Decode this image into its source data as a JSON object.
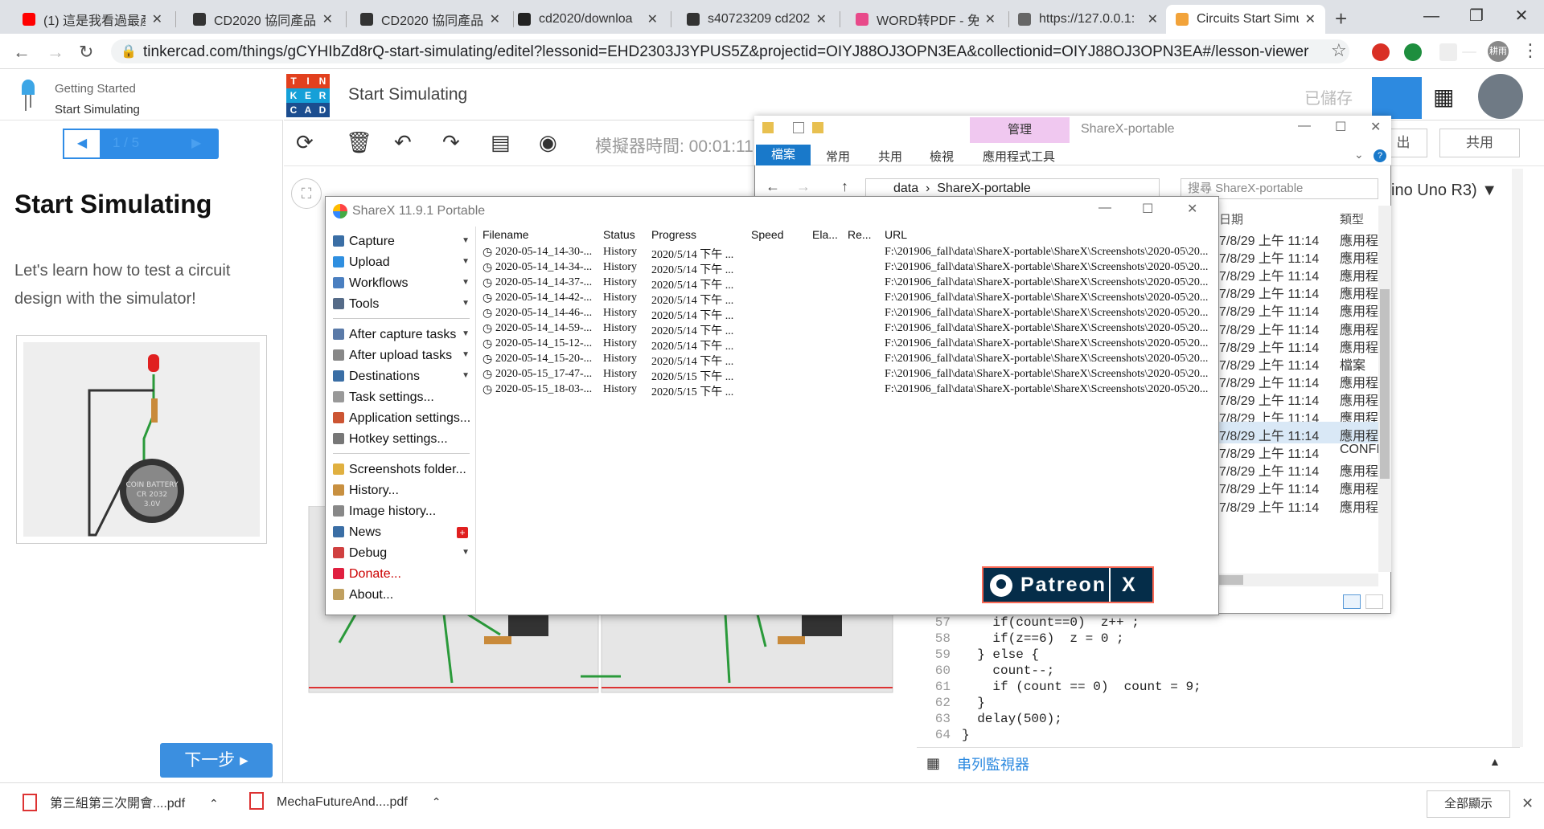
{
  "browser": {
    "tabs": [
      {
        "title": "(1) 這是我看過最產",
        "color": "#ff0000"
      },
      {
        "title": "CD2020 協同產品",
        "color": "#333333"
      },
      {
        "title": "CD2020 協同產品",
        "color": "#333333"
      },
      {
        "title": "cd2020/downloa",
        "color": "#222222"
      },
      {
        "title": "s40723209 cd202",
        "color": "#333333"
      },
      {
        "title": "WORD转PDF - 免",
        "color": "#e84a8a"
      },
      {
        "title": "https://127.0.0.1:",
        "color": "#666666"
      },
      {
        "title": "Circuits Start Simu",
        "color": "#f2a33a"
      }
    ],
    "url": "tinkercad.com/things/gCYHIbZd8rQ-start-simulating/editel?lessonid=EHD2303J3YPUS5Z&projectid=OIYJ88OJ3OPN3EA&collectionid=OIYJ88OJ3OPN3EA#/lesson-viewer",
    "profile_label": "耕雨"
  },
  "lesson": {
    "breadcrumb_top": "Getting Started",
    "breadcrumb_bottom": "Start Simulating",
    "pager": "1 / 5",
    "title": "Start Simulating",
    "text": "Let's learn how to test a circuit design with the simulator!",
    "next_label": "下一步 ▸"
  },
  "tinkercad": {
    "logo_letters": [
      "T",
      "I",
      "N",
      "K",
      "E",
      "R",
      "C",
      "A",
      "D"
    ],
    "logo_colors": [
      "#e2401e",
      "#e2401e",
      "#e2401e",
      "#15a0d8",
      "#15a0d8",
      "#15a0d8",
      "#1b4d8f",
      "#1b4d8f",
      "#1b4d8f"
    ],
    "title": "Start Simulating",
    "saved": "已儲存",
    "sim_time": "模擬器時間: 00:01:11",
    "export_label": "出",
    "share_label": "共用",
    "board": "ino Uno R3)"
  },
  "code": [
    {
      "n": "57",
      "t": "    if(count==0)  z++ ;"
    },
    {
      "n": "58",
      "t": "    if(z==6)  z = 0 ;"
    },
    {
      "n": "59",
      "t": "  } else {"
    },
    {
      "n": "60",
      "t": "    count--;"
    },
    {
      "n": "61",
      "t": "    if (count == 0)  count = 9;"
    },
    {
      "n": "62",
      "t": "  }"
    },
    {
      "n": "63",
      "t": "  delay(500);"
    },
    {
      "n": "64",
      "t": "}"
    }
  ],
  "serial_monitor": "串列監視器",
  "explorer": {
    "manage_tab": "管理",
    "window_name": "ShareX-portable",
    "ribbon": [
      "檔案",
      "常用",
      "共用",
      "檢視",
      "應用程式工具"
    ],
    "path": [
      "data",
      "ShareX-portable"
    ],
    "search_placeholder": "搜尋 ShareX-portable",
    "col_date": "日期",
    "col_type": "類型",
    "rows": [
      {
        "date": "7/8/29 上午 11:14",
        "type": "應用程"
      },
      {
        "date": "7/8/29 上午 11:14",
        "type": "應用程"
      },
      {
        "date": "7/8/29 上午 11:14",
        "type": "應用程"
      },
      {
        "date": "7/8/29 上午 11:14",
        "type": "應用程"
      },
      {
        "date": "7/8/29 上午 11:14",
        "type": "應用程"
      },
      {
        "date": "7/8/29 上午 11:14",
        "type": "應用程"
      },
      {
        "date": "7/8/29 上午 11:14",
        "type": "應用程"
      },
      {
        "date": "7/8/29 上午 11:14",
        "type": "檔案"
      },
      {
        "date": "7/8/29 上午 11:14",
        "type": "應用程"
      },
      {
        "date": "7/8/29 上午 11:14",
        "type": "應用程"
      },
      {
        "date": "7/8/29 上午 11:14",
        "type": "應用程"
      },
      {
        "date": "7/8/29 上午 11:14",
        "type": "應用程"
      },
      {
        "date": "7/8/29 上午 11:14",
        "type": "CONFI"
      },
      {
        "date": "7/8/29 上午 11:14",
        "type": "應用程"
      },
      {
        "date": "7/8/29 上午 11:14",
        "type": "應用程"
      },
      {
        "date": "7/8/29 上午 11:14",
        "type": "應用程"
      }
    ]
  },
  "sharex": {
    "title": "ShareX 11.9.1 Portable",
    "menu": [
      {
        "label": "Capture",
        "color": "#3a6ea5",
        "arrow": true
      },
      {
        "label": "Upload",
        "color": "#2f8fe0",
        "arrow": true
      },
      {
        "label": "Workflows",
        "color": "#4a7fc0",
        "arrow": true
      },
      {
        "label": "Tools",
        "color": "#556b88",
        "arrow": true
      },
      {
        "label": "After capture tasks",
        "color": "#5a7aa8",
        "arrow": true
      },
      {
        "label": "After upload tasks",
        "color": "#888888",
        "arrow": true
      },
      {
        "label": "Destinations",
        "color": "#3a6ea5",
        "arrow": true
      },
      {
        "label": "Task settings...",
        "color": "#999999",
        "arrow": false
      },
      {
        "label": "Application settings...",
        "color": "#cc5533",
        "arrow": false
      },
      {
        "label": "Hotkey settings...",
        "color": "#777777",
        "arrow": false
      },
      {
        "label": "Screenshots folder...",
        "color": "#e0b040",
        "arrow": false
      },
      {
        "label": "History...",
        "color": "#c89040",
        "arrow": false
      },
      {
        "label": "Image history...",
        "color": "#888888",
        "arrow": false
      },
      {
        "label": "News",
        "color": "#3a6ea5",
        "arrow": false
      },
      {
        "label": "Debug",
        "color": "#d04040",
        "arrow": true
      },
      {
        "label": "Donate...",
        "color": "#e02040",
        "arrow": false
      },
      {
        "label": "About...",
        "color": "#c0a060",
        "arrow": false
      }
    ],
    "columns": [
      "Filename",
      "Status",
      "Progress",
      "Speed",
      "Ela...",
      "Re...",
      "URL"
    ],
    "rows": [
      {
        "file": "2020-05-14_14-30-...",
        "status": "History",
        "progress": "2020/5/14 下午 ...",
        "url": "F:\\201906_fall\\data\\ShareX-portable\\ShareX\\Screenshots\\2020-05\\20..."
      },
      {
        "file": "2020-05-14_14-34-...",
        "status": "History",
        "progress": "2020/5/14 下午 ...",
        "url": "F:\\201906_fall\\data\\ShareX-portable\\ShareX\\Screenshots\\2020-05\\20..."
      },
      {
        "file": "2020-05-14_14-37-...",
        "status": "History",
        "progress": "2020/5/14 下午 ...",
        "url": "F:\\201906_fall\\data\\ShareX-portable\\ShareX\\Screenshots\\2020-05\\20..."
      },
      {
        "file": "2020-05-14_14-42-...",
        "status": "History",
        "progress": "2020/5/14 下午 ...",
        "url": "F:\\201906_fall\\data\\ShareX-portable\\ShareX\\Screenshots\\2020-05\\20..."
      },
      {
        "file": "2020-05-14_14-46-...",
        "status": "History",
        "progress": "2020/5/14 下午 ...",
        "url": "F:\\201906_fall\\data\\ShareX-portable\\ShareX\\Screenshots\\2020-05\\20..."
      },
      {
        "file": "2020-05-14_14-59-...",
        "status": "History",
        "progress": "2020/5/14 下午 ...",
        "url": "F:\\201906_fall\\data\\ShareX-portable\\ShareX\\Screenshots\\2020-05\\20..."
      },
      {
        "file": "2020-05-14_15-12-...",
        "status": "History",
        "progress": "2020/5/14 下午 ...",
        "url": "F:\\201906_fall\\data\\ShareX-portable\\ShareX\\Screenshots\\2020-05\\20..."
      },
      {
        "file": "2020-05-14_15-20-...",
        "status": "History",
        "progress": "2020/5/14 下午 ...",
        "url": "F:\\201906_fall\\data\\ShareX-portable\\ShareX\\Screenshots\\2020-05\\20..."
      },
      {
        "file": "2020-05-15_17-47-...",
        "status": "History",
        "progress": "2020/5/15 下午 ...",
        "url": "F:\\201906_fall\\data\\ShareX-portable\\ShareX\\Screenshots\\2020-05\\20..."
      },
      {
        "file": "2020-05-15_18-03-...",
        "status": "History",
        "progress": "2020/5/15 下午 ...",
        "url": "F:\\201906_fall\\data\\ShareX-portable\\ShareX\\Screenshots\\2020-05\\20..."
      }
    ],
    "patreon": "Patreon",
    "patreon_close": "X"
  },
  "downloads": {
    "items": [
      "第三組第三次開會....pdf",
      "MechaFutureAnd....pdf"
    ],
    "show_all": "全部顯示"
  }
}
